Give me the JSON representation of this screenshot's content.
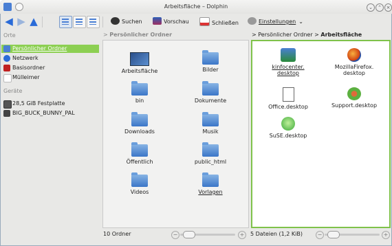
{
  "window": {
    "title": "Arbeitsfläche – Dolphin"
  },
  "toolbar": {
    "search_label": "Suchen",
    "preview_label": "Vorschau",
    "split_label": "Schließen",
    "settings_label": "Einstellungen"
  },
  "places": {
    "section_places": "Orte",
    "items": [
      {
        "label": "Persönlicher Ordner",
        "selected": true
      },
      {
        "label": "Netzwerk"
      },
      {
        "label": "Basisordner"
      },
      {
        "label": "Mülleimer"
      }
    ],
    "section_devices": "Geräte",
    "devices": [
      {
        "label": "28,5 GiB Festplatte"
      },
      {
        "label": "BIG_BUCK_BUNNY_PAL"
      }
    ]
  },
  "left_pane": {
    "breadcrumb": "Persönlicher Ordner",
    "items": [
      {
        "label": "Arbeitsfläche",
        "icon": "desktop-icon"
      },
      {
        "label": "Bilder",
        "icon": "folder-icon"
      },
      {
        "label": "bin",
        "icon": "folder-icon"
      },
      {
        "label": "Dokumente",
        "icon": "folder-icon"
      },
      {
        "label": "Downloads",
        "icon": "folder-icon"
      },
      {
        "label": "Musik",
        "icon": "folder-icon"
      },
      {
        "label": "Öffentlich",
        "icon": "folder-icon"
      },
      {
        "label": "public_html",
        "icon": "folder-icon"
      },
      {
        "label": "Videos",
        "icon": "folder-icon"
      },
      {
        "label": "Vorlagen",
        "icon": "folder-icon"
      }
    ],
    "status": "10 Ordner"
  },
  "right_pane": {
    "breadcrumb_parent": "Persönlicher Ordner",
    "breadcrumb_sep": ">",
    "breadcrumb_current": "Arbeitsfläche",
    "items": [
      {
        "label": "kinfocenter.\ndesktop",
        "icon": "kinfocenter-icon"
      },
      {
        "label": "MozillaFirefox.\ndesktop",
        "icon": "firefox-icon"
      },
      {
        "label": "Office.desktop",
        "icon": "document-icon"
      },
      {
        "label": "Support.desktop",
        "icon": "support-icon"
      },
      {
        "label": "SuSE.desktop",
        "icon": "suse-icon"
      }
    ],
    "status": "5 Dateien (1,2 KiB)"
  },
  "colors": {
    "accent": "#7fc24a",
    "selection": "#8ccf52",
    "folder": "#3b76c8"
  }
}
